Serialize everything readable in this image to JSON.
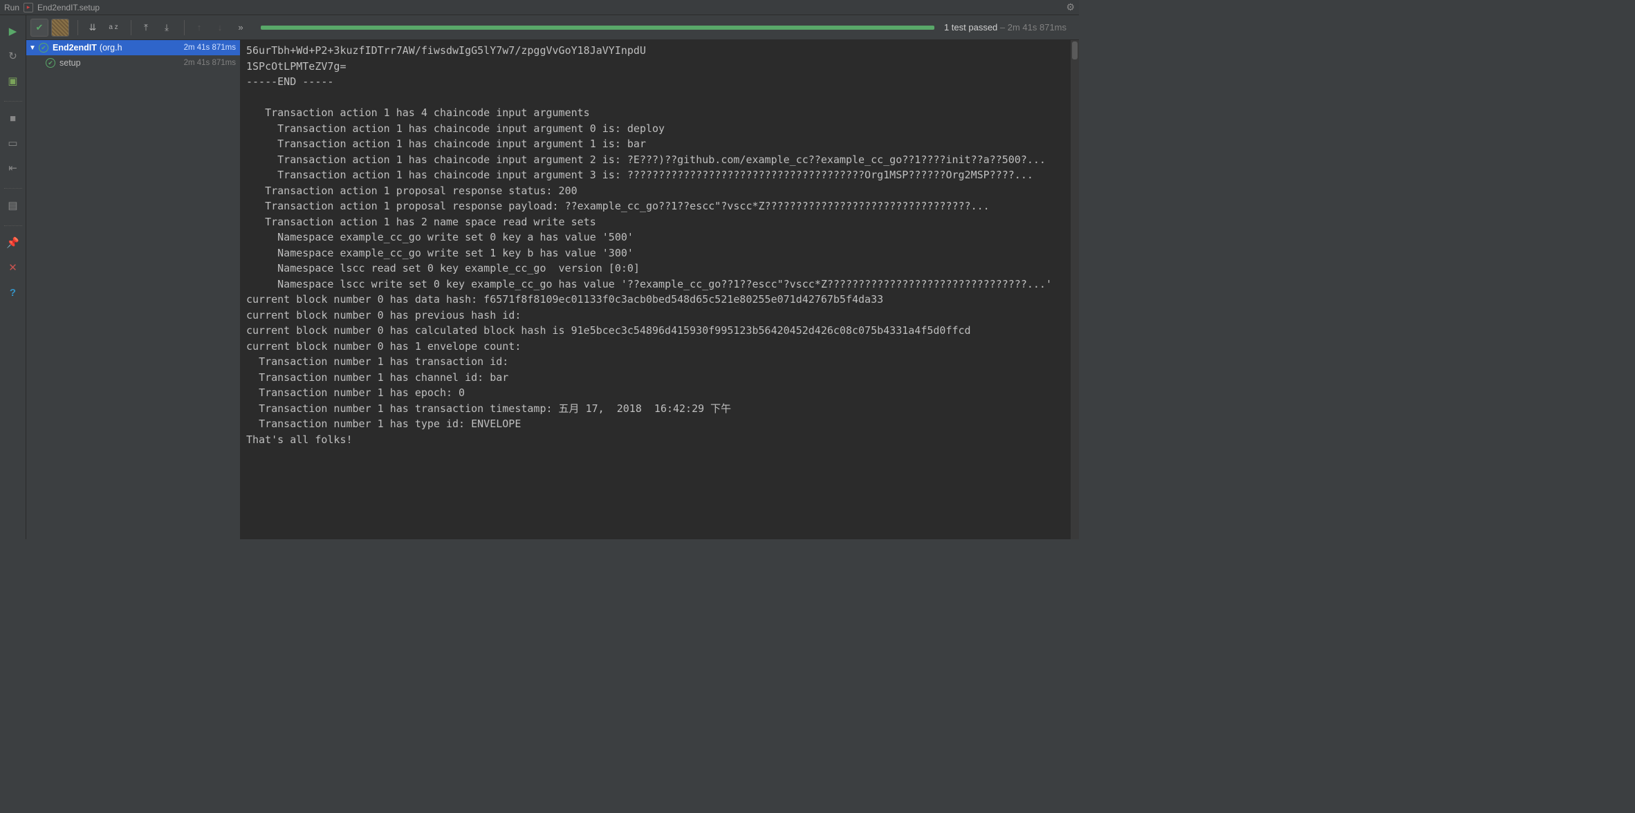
{
  "titlebar": {
    "run_label": "Run",
    "config_name": "End2endIT.setup"
  },
  "toolbar": {
    "summary_passed": "1 test passed",
    "summary_time": " – 2m 41s 871ms",
    "sort_icon_label": "a z",
    "more_label": "»"
  },
  "tree": {
    "root": {
      "name": "End2endIT",
      "pkg": "(org.h",
      "time": "2m 41s 871ms"
    },
    "child": {
      "name": "setup",
      "time": "2m 41s 871ms"
    }
  },
  "console_lines": [
    "56urTbh+Wd+P2+3kuzfIDTrr7AW/fiwsdwIgG5lY7w7/zpggVvGoY18JaVYInpdU",
    "1SPcOtLPMTeZV7g=",
    "-----END -----",
    "",
    "   Transaction action 1 has 4 chaincode input arguments",
    "     Transaction action 1 has chaincode input argument 0 is: deploy",
    "     Transaction action 1 has chaincode input argument 1 is: bar",
    "     Transaction action 1 has chaincode input argument 2 is: ?E???)??github.com/example_cc??example_cc_go??1????init??a??500?...",
    "     Transaction action 1 has chaincode input argument 3 is: ??????????????????????????????????????Org1MSP??????Org2MSP????...",
    "   Transaction action 1 proposal response status: 200",
    "   Transaction action 1 proposal response payload: ??example_cc_go??1??escc\"?vscc*Z?????????????????????????????????...",
    "   Transaction action 1 has 2 name space read write sets",
    "     Namespace example_cc_go write set 0 key a has value '500'",
    "     Namespace example_cc_go write set 1 key b has value '300'",
    "     Namespace lscc read set 0 key example_cc_go  version [0:0]",
    "     Namespace lscc write set 0 key example_cc_go has value '??example_cc_go??1??escc\"?vscc*Z????????????????????????????????...'",
    "current block number 0 has data hash: f6571f8f8109ec01133f0c3acb0bed548d65c521e80255e071d42767b5f4da33",
    "current block number 0 has previous hash id: ",
    "current block number 0 has calculated block hash is 91e5bcec3c54896d415930f995123b56420452d426c08c075b4331a4f5d0ffcd",
    "current block number 0 has 1 envelope count:",
    "  Transaction number 1 has transaction id: ",
    "  Transaction number 1 has channel id: bar",
    "  Transaction number 1 has epoch: 0",
    "  Transaction number 1 has transaction timestamp: 五月 17,  2018  16:42:29 下午",
    "  Transaction number 1 has type id: ENVELOPE",
    "That's all folks!"
  ]
}
